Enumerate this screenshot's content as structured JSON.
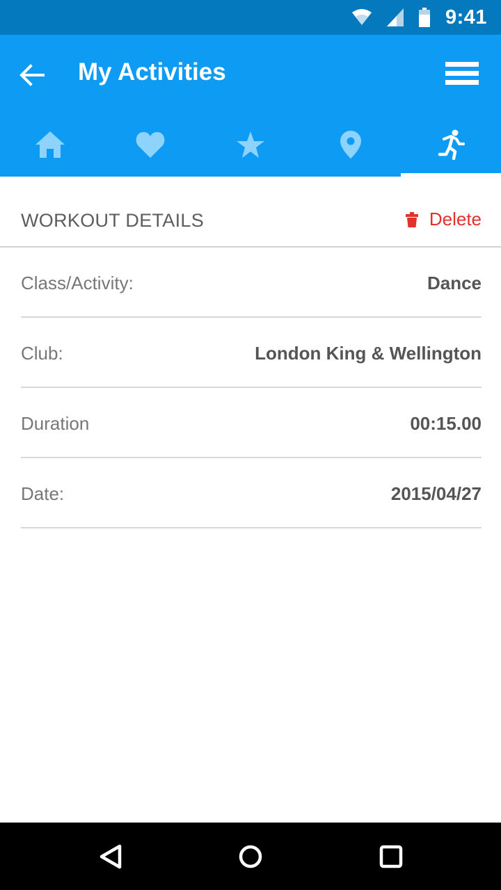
{
  "status_bar": {
    "time": "9:41",
    "icons": [
      "wifi-icon",
      "cellular-signal-icon",
      "battery-icon"
    ]
  },
  "app_bar": {
    "title": "My Activities",
    "back_icon": "arrow-left-icon",
    "menu_icon": "hamburger-menu-icon",
    "background_color": "#0d9bf4",
    "tabs": [
      {
        "icon": "home-icon",
        "selected": false
      },
      {
        "icon": "heart-icon",
        "selected": false
      },
      {
        "icon": "star-icon",
        "selected": false
      },
      {
        "icon": "location-pin-icon",
        "selected": false
      },
      {
        "icon": "running-person-icon",
        "selected": true
      }
    ]
  },
  "section": {
    "title": "WORKOUT DETAILS",
    "delete_label": "Delete",
    "delete_color": "#e3312b"
  },
  "details": [
    {
      "label": "Class/Activity:",
      "value": "Dance"
    },
    {
      "label": "Club:",
      "value": "London King & Wellington"
    },
    {
      "label": "Duration",
      "value": "00:15.00"
    },
    {
      "label": "Date:",
      "value": "2015/04/27"
    }
  ],
  "nav_bar": {
    "buttons": [
      "back-triangle-icon",
      "home-circle-icon",
      "recents-square-icon"
    ]
  }
}
